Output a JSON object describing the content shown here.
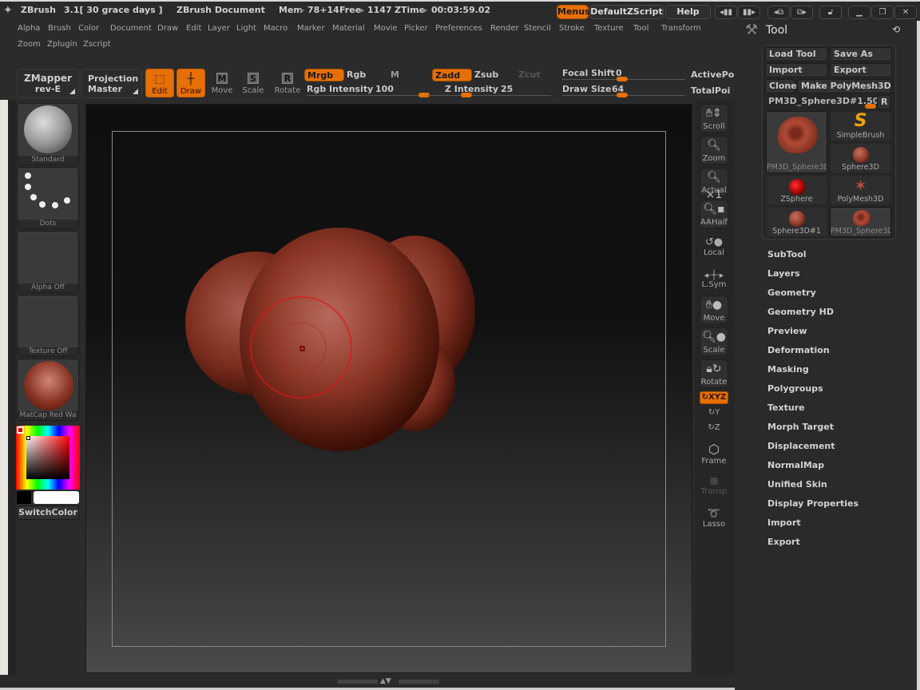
{
  "titlebar": {
    "app": "ZBrush",
    "version": "3.1[ 30 grace days ]",
    "document": "ZBrush Document",
    "mem_label": "Mem",
    "mem_value": "78+14",
    "free_label": "Free",
    "free_value": "1147",
    "ztime_label": "ZTime",
    "ztime_value": "00:03:59.02",
    "menus_button": "Menus",
    "script_button": "DefaultZScript",
    "help_button": "Help"
  },
  "menubar": {
    "row1": [
      "Alpha",
      "Brush",
      "Color",
      "Document",
      "Draw",
      "Edit",
      "Layer",
      "Light",
      "Macro",
      "Marker",
      "Material",
      "Movie",
      "Picker",
      "Preferences",
      "Render",
      "Stencil",
      "Stroke",
      "Texture",
      "Tool",
      "Transform"
    ],
    "row2": [
      "Zoom",
      "Zplugin",
      "Zscript"
    ]
  },
  "toolbar": {
    "zmapper_line1": "ZMapper",
    "zmapper_line2": "rev-E",
    "projection_line1": "Projection",
    "projection_line2": "Master",
    "edit": "Edit",
    "draw": "Draw",
    "move": "Move",
    "scale": "Scale",
    "rotate": "Rotate",
    "mrgb": "Mrgb",
    "rgb": "Rgb",
    "m": "M",
    "rgb_intensity_label": "Rgb Intensity",
    "rgb_intensity_value": "100",
    "zadd": "Zadd",
    "zsub": "Zsub",
    "zcut": "Zcut",
    "z_intensity_label": "Z Intensity",
    "z_intensity_value": "25",
    "focal_shift_label": "Focal Shift",
    "focal_shift_value": "0",
    "draw_size_label": "Draw Size",
    "draw_size_value": "64",
    "active_points": "ActivePo",
    "total_points": "TotalPoi"
  },
  "left_shelf": {
    "brush": "Standard",
    "stroke": "Dots",
    "alpha": "Alpha Off",
    "texture": "Texture Off",
    "material": "MatCap Red Wa",
    "switch_color": "SwitchColor",
    "main_color": "#000000",
    "secondary_color": "#ffffff"
  },
  "right_shelf": {
    "scroll": "Scroll",
    "zoom": "Zoom",
    "actual": "Actual",
    "aahalf": "AAHalf",
    "local": "Local",
    "lsym": "L.Sym",
    "move": "Move",
    "scale": "Scale",
    "rotate": "Rotate",
    "xyz": "XYZ",
    "y": "Y",
    "z": "Z",
    "frame": "Frame",
    "transp": "Transp",
    "lasso": "Lasso"
  },
  "tool_panel": {
    "title": "Tool",
    "load_tool": "Load Tool",
    "save_as": "Save As",
    "import": "Import",
    "export": "Export",
    "clone": "Clone",
    "make_polymesh": "Make PolyMesh3D",
    "current_tool": "PM3D_Sphere3D#1.",
    "current_value": "50",
    "r_button": "R",
    "tools": [
      {
        "name": "PM3D_Sphere3D"
      },
      {
        "name": "SimpleBrush"
      },
      {
        "name": "Sphere3D"
      },
      {
        "name": "ZSphere"
      },
      {
        "name": "PolyMesh3D"
      },
      {
        "name": "Sphere3D#1"
      },
      {
        "name": "PM3D_Sphere3D"
      }
    ],
    "subpalettes": [
      "SubTool",
      "Layers",
      "Geometry",
      "Geometry HD",
      "Preview",
      "Deformation",
      "Masking",
      "Polygroups",
      "Texture",
      "Morph Target",
      "Displacement",
      "NormalMap",
      "Unified Skin",
      "Display Properties",
      "Import",
      "Export"
    ]
  },
  "colors": {
    "accent": "#e66f06",
    "background": "#2b2b2b",
    "model": "#8a3524"
  }
}
